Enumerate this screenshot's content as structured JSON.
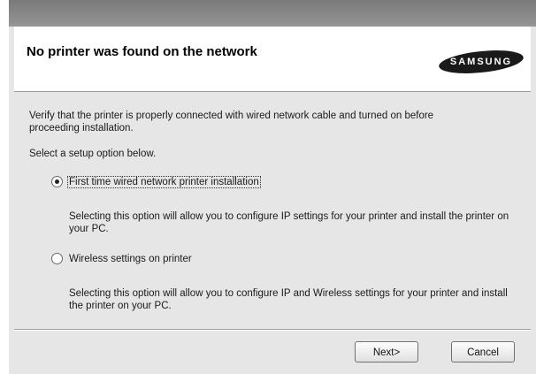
{
  "header": {
    "title": "No printer was found on the network",
    "logo_text": "SAMSUNG"
  },
  "content": {
    "verify_text_line1": "Verify that the printer is properly connected with wired network cable and turned on before",
    "verify_text_line2": "proceeding installation.",
    "select_text": "Select a setup option below.",
    "options": [
      {
        "label": "First time wired network printer installation",
        "selected": true,
        "description_line1": "Selecting this option will allow you to configure IP settings for your printer and install the printer on",
        "description_line2": "your PC."
      },
      {
        "label": "Wireless settings on printer",
        "selected": false,
        "description_line1": "Selecting this option will allow you to configure IP and Wireless settings for your printer and install",
        "description_line2": "the printer on your PC."
      }
    ]
  },
  "buttons": {
    "next": "Next>",
    "cancel": "Cancel"
  }
}
